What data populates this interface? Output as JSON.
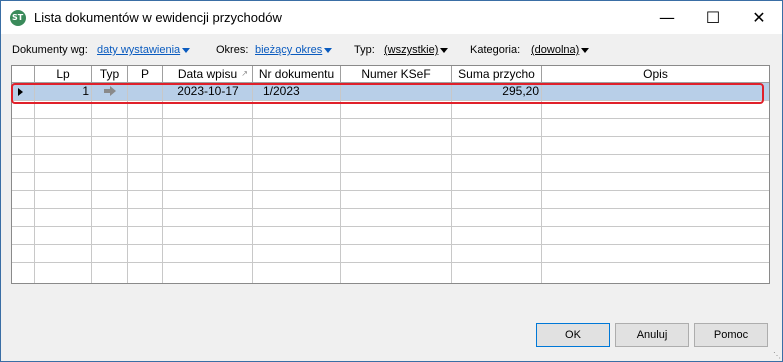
{
  "window": {
    "title": "Lista dokumentów w ewidencji przychodów",
    "icon": "app-logo-icon",
    "icon_text": "ST",
    "minimize_glyph": "—",
    "maximize_glyph": "☐",
    "close_glyph": "✕"
  },
  "filters": {
    "dokumenty_label": "Dokumenty wg:",
    "dokumenty_value": "daty wystawienia",
    "okres_label": "Okres:",
    "okres_value": "bieżący okres",
    "typ_label": "Typ:",
    "typ_value": "(wszystkie)",
    "kategoria_label": "Kategoria:",
    "kategoria_value": "(dowolna)"
  },
  "table": {
    "columns": [
      "Lp",
      "Typ",
      "P",
      "Data wpisu",
      "Nr dokumentu",
      "Numer KSeF",
      "Suma przycho",
      "Opis"
    ],
    "rows": [
      {
        "lp": "1",
        "typ": "arrow-right-icon",
        "p": "",
        "data": "2023-10-17",
        "nr": "1/2023",
        "ksef": "",
        "suma": "295,20",
        "opis": ""
      }
    ],
    "selected_row": 0
  },
  "buttons": {
    "ok": "OK",
    "cancel": "Anuluj",
    "help": "Pomoc"
  },
  "colors": {
    "link": "#0a5bbf",
    "selection": "#b8cfe8",
    "highlight_border": "#e0202a"
  }
}
